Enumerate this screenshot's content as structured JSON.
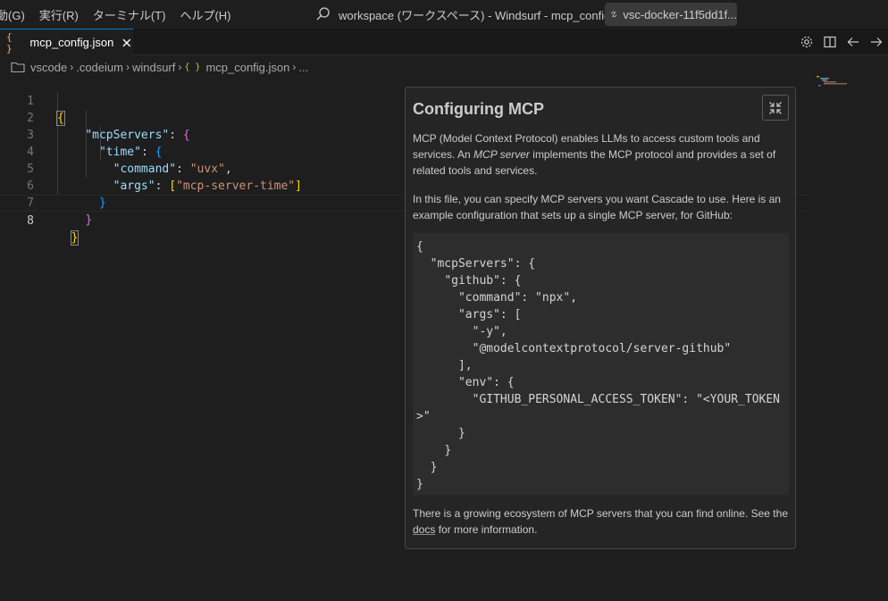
{
  "menu": {
    "items": [
      "動(G)",
      "実行(R)",
      "ターミナル(T)",
      "ヘルプ(H)"
    ]
  },
  "titlebar": {
    "search_text": "workspace (ワークスペース) - Windsurf - mcp_config.json",
    "remote_label": "vsc-docker-11f5dd1f..."
  },
  "tab": {
    "icon_text": "{ }",
    "label": "mcp_config.json"
  },
  "breadcrumb": {
    "items": [
      "vscode",
      ".codeium",
      "windsurf",
      "mcp_config.json",
      "..."
    ]
  },
  "editor": {
    "line_numbers": [
      "1",
      "2",
      "3",
      "4",
      "5",
      "6",
      "7",
      "8"
    ],
    "active_line": "8"
  },
  "hover": {
    "title": "Configuring MCP",
    "p1_a": "MCP (Model Context Protocol) enables LLMs to access custom tools and services. An ",
    "p1_em": "MCP server",
    "p1_b": " implements the MCP protocol and provides a set of related tools and services.",
    "p2": "In this file, you can specify MCP servers you want Cascade to use. Here is an example configuration that sets up a single MCP server, for GitHub:",
    "code": "{\n  \"mcpServers\": {\n    \"github\": {\n      \"command\": \"npx\",\n      \"args\": [\n        \"-y\",\n        \"@modelcontextprotocol/server-github\"\n      ],\n      \"env\": {\n        \"GITHUB_PERSONAL_ACCESS_TOKEN\": \"<YOUR_TOKEN>\"\n      }\n    }\n  }\n}",
    "p3_a": "There is a growing ecosystem of MCP servers that you can find online. See the ",
    "p3_link": "docs",
    "p3_b": " for more information."
  },
  "colors": {
    "accent": "#0078d4",
    "json_icon": "#e8b34e",
    "key": "#9cdcfe",
    "string": "#ce9178",
    "bracket_gold": "#ffd700",
    "bracket_purple": "#da70d6",
    "bracket_blue": "#179fff"
  }
}
